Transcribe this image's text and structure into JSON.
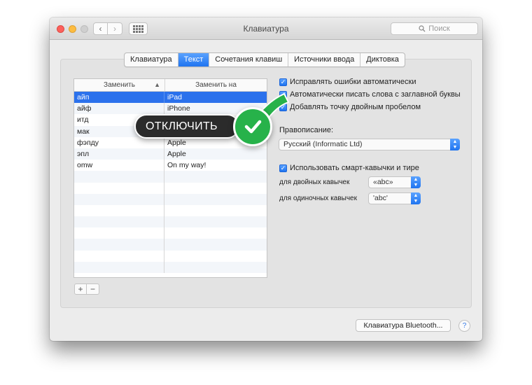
{
  "window": {
    "title": "Клавиатура",
    "search_placeholder": "Поиск",
    "back_symbol": "‹",
    "forward_symbol": "›"
  },
  "tabs": [
    {
      "label": "Клавиатура",
      "active": false
    },
    {
      "label": "Текст",
      "active": true
    },
    {
      "label": "Сочетания клавиш",
      "active": false
    },
    {
      "label": "Источники ввода",
      "active": false
    },
    {
      "label": "Диктовка",
      "active": false
    }
  ],
  "replacements": {
    "col_replace": "Заменить",
    "col_with": "Заменить на",
    "sort_indicator": "▲",
    "rows": [
      {
        "replace": "айп",
        "with": "iPad",
        "selected": true
      },
      {
        "replace": "айф",
        "with": "iPhone",
        "selected": false
      },
      {
        "replace": "итд",
        "with": "",
        "selected": false
      },
      {
        "replace": "мак",
        "with": "",
        "selected": false
      },
      {
        "replace": "фэпду",
        "with": "Apple",
        "selected": false
      },
      {
        "replace": "эпл",
        "with": "Apple",
        "selected": false
      },
      {
        "replace": "omw",
        "with": "On my way!",
        "selected": false
      }
    ],
    "add_label": "+",
    "remove_label": "−"
  },
  "options": {
    "autocorrect": {
      "label": "Исправлять ошибки автоматически",
      "checked": true
    },
    "autocapitalize": {
      "label": "Автоматически писать слова с заглавной буквы",
      "checked": true
    },
    "double_space_period": {
      "label": "Добавлять точку двойным пробелом",
      "checked": true
    },
    "spelling_label": "Правописание:",
    "spelling_value": "Русский (Informatic Ltd)",
    "smart_quotes": {
      "label": "Использовать смарт-кавычки и тире",
      "checked": true
    },
    "double_quotes_label": "для двойных кавычек",
    "double_quotes_value": "«abc»",
    "single_quotes_label": "для одиночных кавычек",
    "single_quotes_value": "'abc'",
    "check_mark": "✓"
  },
  "bluetooth_button": "Клавиатура Bluetooth...",
  "help_symbol": "?",
  "callout": {
    "text": "ОТКЛЮЧИТЬ"
  },
  "colors": {
    "accent": "#1f74f0",
    "callout_bg": "#2b2b2b",
    "check_green": "#27b24a"
  }
}
